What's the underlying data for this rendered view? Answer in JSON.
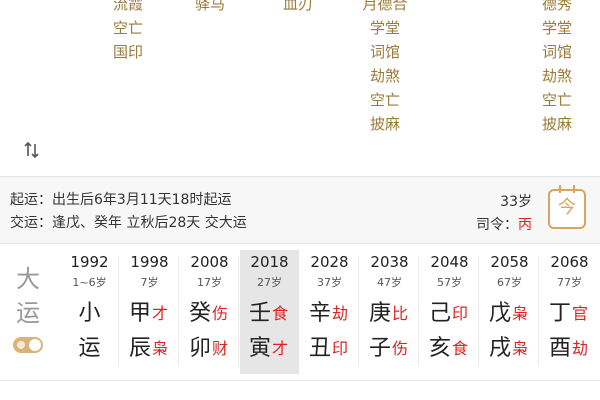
{
  "shensha_columns": [
    {
      "top_partial": "流霞",
      "items": [
        "空亡",
        "国印"
      ]
    },
    {
      "top_partial": "驿马",
      "items": []
    },
    {
      "top_partial": "血刃",
      "items": []
    },
    {
      "top_partial": "月德合",
      "items": [
        "学堂",
        "词馆",
        "劫煞",
        "空亡",
        "披麻"
      ]
    },
    {
      "top_partial": "德秀",
      "items": [
        "学堂",
        "词馆",
        "劫煞",
        "空亡",
        "披麻"
      ]
    }
  ],
  "sort_icon": "up-down-arrows-icon",
  "qiyun": "起运：出生后6年3月11天18时起运",
  "jiaoyun": "交运：逢戊、癸年 立秋后28天 交大运",
  "current_age": "33岁",
  "siling_label": "司令：",
  "siling_value": "丙",
  "calendar_icon_text": "今",
  "dayun_label_1": "大",
  "dayun_label_2": "运",
  "colors": {
    "accent": "#d9b37a",
    "red": "#dd2222",
    "gold_text": "#9b7a3a",
    "selected_bg": "#e6e6e6"
  },
  "columns": [
    {
      "year": "1992",
      "age": "1~6岁",
      "gan": "小",
      "zhi": "运",
      "gan_shen": "",
      "zhi_shen": ""
    },
    {
      "year": "1998",
      "age": "7岁",
      "gan": "甲",
      "zhi": "辰",
      "gan_shen": "才",
      "zhi_shen": "枭"
    },
    {
      "year": "2008",
      "age": "17岁",
      "gan": "癸",
      "zhi": "卯",
      "gan_shen": "伤",
      "zhi_shen": "财"
    },
    {
      "year": "2018",
      "age": "27岁",
      "gan": "壬",
      "zhi": "寅",
      "gan_shen": "食",
      "zhi_shen": "才"
    },
    {
      "year": "2028",
      "age": "37岁",
      "gan": "辛",
      "zhi": "丑",
      "gan_shen": "劫",
      "zhi_shen": "印"
    },
    {
      "year": "2038",
      "age": "47岁",
      "gan": "庚",
      "zhi": "子",
      "gan_shen": "比",
      "zhi_shen": "伤"
    },
    {
      "year": "2048",
      "age": "57岁",
      "gan": "己",
      "zhi": "亥",
      "gan_shen": "印",
      "zhi_shen": "食"
    },
    {
      "year": "2058",
      "age": "67岁",
      "gan": "戊",
      "zhi": "戌",
      "gan_shen": "枭",
      "zhi_shen": "枭"
    },
    {
      "year": "2068",
      "age": "77岁",
      "gan": "丁",
      "zhi": "酉",
      "gan_shen": "官",
      "zhi_shen": "劫"
    }
  ],
  "selected_index": 3
}
